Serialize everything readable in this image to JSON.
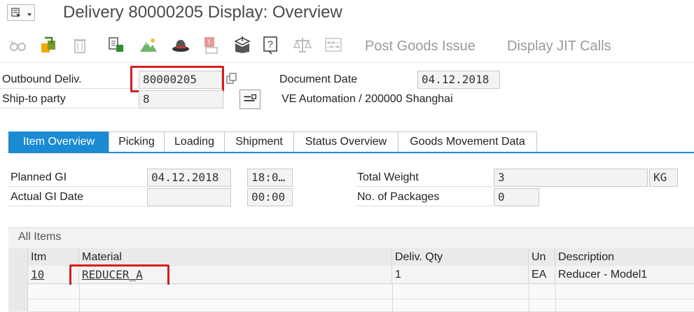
{
  "title": "Delivery 80000205 Display: Overview",
  "toolbar": {
    "icons": [
      "glasses-icon",
      "switch-display-icon",
      "trash-icon",
      "copy-icon",
      "mountain-image-icon",
      "hat-icon",
      "flag-doc-icon",
      "package-icon",
      "help-doc-icon",
      "scale-icon",
      "abacus-icon"
    ],
    "post_goods_issue": "Post Goods Issue",
    "display_jit_calls": "Display JIT Calls"
  },
  "header": {
    "outbound_label": "Outbound Deliv.",
    "outbound_value": "80000205",
    "shipto_label": "Ship-to party",
    "shipto_value": "8",
    "shipto_name": "VE Automation / 200000 Shanghai",
    "doc_date_label": "Document Date",
    "doc_date_value": "04.12.2018"
  },
  "tabs": [
    "Item Overview",
    "Picking",
    "Loading",
    "Shipment",
    "Status Overview",
    "Goods Movement Data"
  ],
  "active_tab": "Item Overview",
  "overview": {
    "planned_gi_label": "Planned GI",
    "planned_gi_date": "04.12.2018",
    "planned_gi_time": "18:0…",
    "actual_gi_label": "Actual GI Date",
    "actual_gi_date": "",
    "actual_gi_time": "00:00",
    "total_weight_label": "Total Weight",
    "total_weight_value": "3",
    "total_weight_unit": "KG",
    "packages_label": "No. of Packages",
    "packages_value": "0"
  },
  "items": {
    "section_title": "All Items",
    "columns": [
      "Itm",
      "Material",
      "Deliv. Qty",
      "Un",
      "Description"
    ],
    "rows": [
      {
        "itm": "10",
        "material": "REDUCER_A",
        "qty": "1",
        "un": "EA",
        "description": "Reducer - Model1"
      }
    ]
  },
  "colors": {
    "accent": "#1a8bd2",
    "highlight": "#d61f1f"
  }
}
